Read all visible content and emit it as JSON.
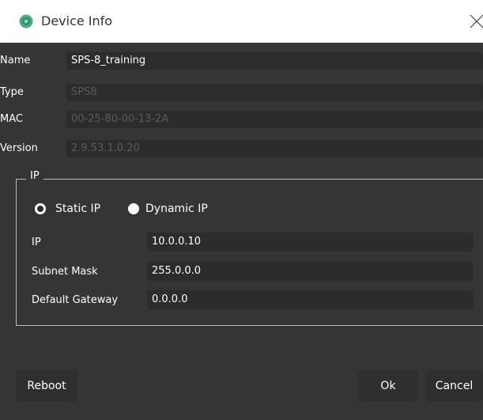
{
  "window": {
    "title": "Device Info"
  },
  "fields": {
    "name": {
      "label": "Name",
      "value": "SPS-8_training"
    },
    "type": {
      "label": "Type",
      "value": "SPS8"
    },
    "mac": {
      "label": "MAC",
      "value": "00-25-80-00-13-2A"
    },
    "version": {
      "label": "Version",
      "value": "2.9.53.1.0.20"
    }
  },
  "ip_group": {
    "title": "IP",
    "static_label": "Static IP",
    "dynamic_label": "Dynamic IP",
    "selected": "Static IP",
    "ip": {
      "label": "IP",
      "value": "10.0.0.10"
    },
    "subnet": {
      "label": "Subnet Mask",
      "value": "255.0.0.0"
    },
    "gateway": {
      "label": "Default Gateway",
      "value": "0.0.0.0"
    }
  },
  "buttons": {
    "reboot": "Reboot",
    "ok": "Ok",
    "cancel": "Cancel"
  }
}
